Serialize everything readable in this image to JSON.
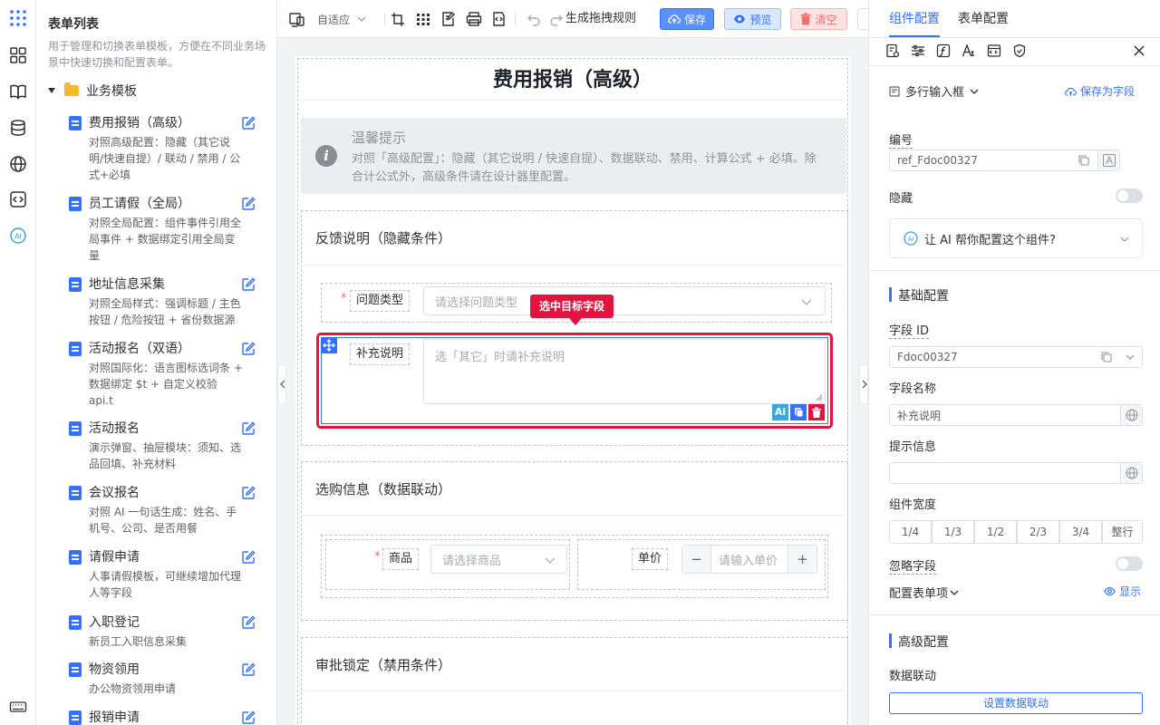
{
  "list": {
    "title": "表单列表",
    "description": "用于管理和切换表单模板，方便在不同业务场景中快速切换和配置表单。",
    "group": "业务模板",
    "templates": [
      {
        "name": "费用报销（高级）",
        "desc": "对照高级配置：隐藏（其它说明/快速自提）/ 联动 / 禁用 / 公式+必填"
      },
      {
        "name": "员工请假（全局）",
        "desc": "对照全局配置：组件事件引用全局事件 + 数据绑定引用全局变量"
      },
      {
        "name": "地址信息采集",
        "desc": "对照全局样式：强调标题 / 主色按钮 / 危险按钮 + 省份数据源"
      },
      {
        "name": "活动报名（双语）",
        "desc": "对照国际化：语言图标选词条 + 数据绑定 $t + 自定义校验 api.t"
      },
      {
        "name": "活动报名",
        "desc": "演示弹窗、抽屉模块：须知、选品回填、补充材料"
      },
      {
        "name": "会议报名",
        "desc": "对照 AI 一句话生成：姓名、手机号、公司、是否用餐"
      },
      {
        "name": "请假申请",
        "desc": "人事请假模板，可继续增加代理人等字段"
      },
      {
        "name": "入职登记",
        "desc": "新员工入职信息采集"
      },
      {
        "name": "物资领用",
        "desc": "办公物资领用申请"
      },
      {
        "name": "报销申请",
        "desc": ""
      }
    ]
  },
  "toolbar": {
    "adapt": "自适应",
    "rules": "生成拖拽规则",
    "save": "保存",
    "preview": "预览",
    "clear": "清空"
  },
  "form": {
    "title": "费用报销（高级）",
    "tip_title": "温馨提示",
    "tip_text": "对照「高级配置」：隐藏（其它说明 / 快速自提）、数据联动、禁用、计算公式 + 必填。除合计公式外，高级条件请在设计器里配置。",
    "section1": "反馈说明（隐藏条件）",
    "q_type_label": "问题类型",
    "q_type_placeholder": "请选择问题类型",
    "selected_badge": "选中目标字段",
    "supplement_label": "补充说明",
    "supplement_placeholder": "选「其它」时请补充说明",
    "section2": "选购信息（数据联动）",
    "product_label": "商品",
    "product_placeholder": "请选择商品",
    "price_label": "单价",
    "price_placeholder": "请输入单价",
    "section3": "审批锁定（禁用条件）",
    "required_mark": "*",
    "minus": "−",
    "plus": "+",
    "ai_badge": "Ai"
  },
  "right": {
    "tab_component": "组件配置",
    "tab_form": "表单配置",
    "component_type": "多行输入框",
    "save_as_field": "保存为字段",
    "label_id": "编号",
    "ref_value": "ref_Fdoc00327",
    "label_hidden": "隐藏",
    "ai_help": "让 AI 帮你配置这个组件?",
    "basic_title": "基础配置",
    "label_field_id": "字段 ID",
    "field_id_value": "Fdoc00327",
    "label_field_name": "字段名称",
    "field_name_value": "补充说明",
    "label_hint": "提示信息",
    "hint_value": "",
    "label_width": "组件宽度",
    "widths": [
      "1/4",
      "1/3",
      "1/2",
      "2/3",
      "3/4",
      "整行"
    ],
    "label_ignore": "忽略字段",
    "config_items": "配置表单项",
    "show": "显示",
    "advanced_title": "高级配置",
    "label_linkage": "数据联动",
    "set_linkage": "设置数据联动"
  },
  "colors": {
    "primary": "#3370ff",
    "danger": "#e3123f",
    "clear_bg": "#fde2e2"
  }
}
